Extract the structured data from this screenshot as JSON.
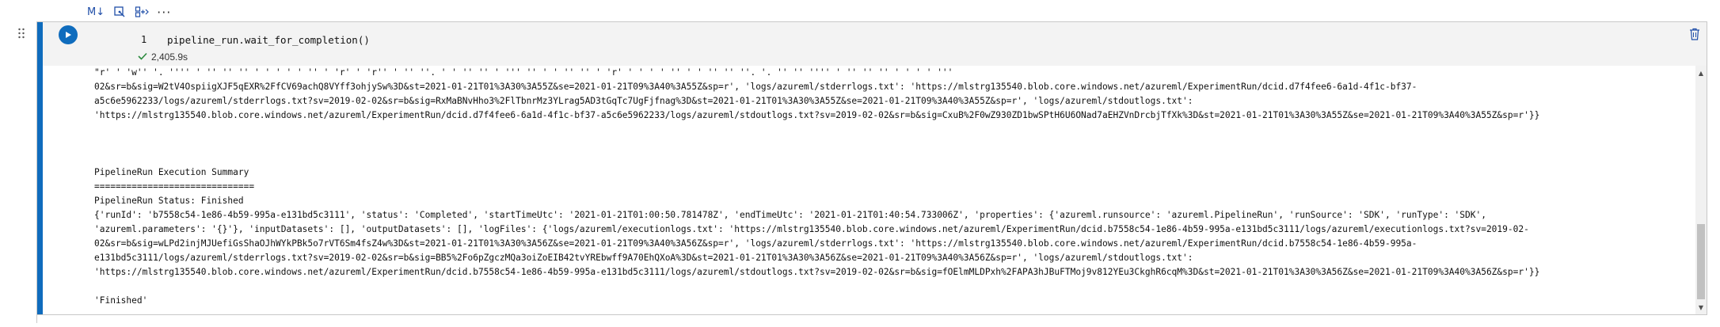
{
  "toolbar": {
    "markdown_label": "M↓",
    "more_label": "···"
  },
  "cell": {
    "line_number": "1",
    "code": "pipeline_run.wait_for_completion()",
    "exec_time": "2,405.9s"
  },
  "output": {
    "lines": [
      "\"r' ' 'w'' '. '''' ' '' '' '' ' ' ' ' ' '' ' 'r' ' 'r'' ' '' ''. ' ' '' '' ' ''' '' ' ' '' '' ' 'r' ' ' ' ' '' ' ' '' '' ''. '. '' '' '''' ' '' '' '' ' ' ' ' '''",
      "02&sr=b&sig=W2tV4OspiigXJF5qEXR%2FfCV69achQ8VYff3ohjySw%3D&st=2021-01-21T01%3A30%3A55Z&se=2021-01-21T09%3A40%3A55Z&sp=r', 'logs/azureml/stderrlogs.txt': 'https://mlstrg135540.blob.core.windows.net/azureml/ExperimentRun/dcid.d7f4fee6-6a1d-4f1c-bf37-",
      "a5c6e5962233/logs/azureml/stderrlogs.txt?sv=2019-02-02&sr=b&sig=RxMaBNvHho3%2FlTbnrMz3YLrag5AD3tGqTc7UgFjfnag%3D&st=2021-01-21T01%3A30%3A55Z&se=2021-01-21T09%3A40%3A55Z&sp=r', 'logs/azureml/stdoutlogs.txt':",
      "'https://mlstrg135540.blob.core.windows.net/azureml/ExperimentRun/dcid.d7f4fee6-6a1d-4f1c-bf37-a5c6e5962233/logs/azureml/stdoutlogs.txt?sv=2019-02-02&sr=b&sig=CxuB%2F0wZ930ZD1bwSPtH6U6ONad7aEHZVnDrcbjTfXk%3D&st=2021-01-21T01%3A30%3A55Z&se=2021-01-21T09%3A40%3A55Z&sp=r'}}",
      "",
      "",
      "",
      "PipelineRun Execution Summary",
      "==============================",
      "PipelineRun Status: Finished",
      "{'runId': 'b7558c54-1e86-4b59-995a-e131bd5c3111', 'status': 'Completed', 'startTimeUtc': '2021-01-21T01:00:50.781478Z', 'endTimeUtc': '2021-01-21T01:40:54.733006Z', 'properties': {'azureml.runsource': 'azureml.PipelineRun', 'runSource': 'SDK', 'runType': 'SDK',",
      "'azureml.parameters': '{}'}, 'inputDatasets': [], 'outputDatasets': [], 'logFiles': {'logs/azureml/executionlogs.txt': 'https://mlstrg135540.blob.core.windows.net/azureml/ExperimentRun/dcid.b7558c54-1e86-4b59-995a-e131bd5c3111/logs/azureml/executionlogs.txt?sv=2019-02-",
      "02&sr=b&sig=wLPd2injMJUefiGsShaOJhWYkPBk5o7rVT6Sm4fsZ4w%3D&st=2021-01-21T01%3A30%3A56Z&se=2021-01-21T09%3A40%3A56Z&sp=r', 'logs/azureml/stderrlogs.txt': 'https://mlstrg135540.blob.core.windows.net/azureml/ExperimentRun/dcid.b7558c54-1e86-4b59-995a-",
      "e131bd5c3111/logs/azureml/stderrlogs.txt?sv=2019-02-02&sr=b&sig=BB5%2Fo6pZgczMQa3oiZoEIB42tvYREbwff9A70EhQXoA%3D&st=2021-01-21T01%3A30%3A56Z&se=2021-01-21T09%3A40%3A56Z&sp=r', 'logs/azureml/stdoutlogs.txt':",
      "'https://mlstrg135540.blob.core.windows.net/azureml/ExperimentRun/dcid.b7558c54-1e86-4b59-995a-e131bd5c3111/logs/azureml/stdoutlogs.txt?sv=2019-02-02&sr=b&sig=fOElmMLDPxh%2FAPA3hJBuFTMoj9v812YEu3CkghR6cqM%3D&st=2021-01-21T01%3A30%3A56Z&se=2021-01-21T09%3A40%3A56Z&sp=r'}}",
      "",
      "'Finished'"
    ]
  },
  "colors": {
    "accent": "#0f6cbd",
    "success": "#2b8a3e"
  },
  "icons": {
    "markdown": "markdown-icon",
    "variable_explorer": "variable-explorer-icon",
    "add_cell": "add-cell-icon",
    "more": "more-icon",
    "run": "play-icon",
    "delete": "trash-icon",
    "check": "check-icon",
    "drag": "drag-handle-icon"
  }
}
